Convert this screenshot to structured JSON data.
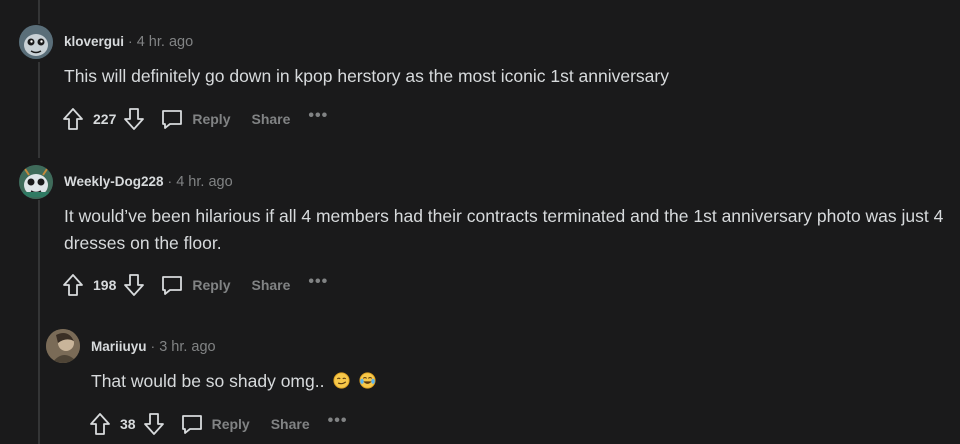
{
  "comments": [
    {
      "author": "klovergui",
      "time": "4 hr. ago",
      "text": "This will definitely go down in kpop herstory as the most iconic 1st anniversary",
      "score": "227",
      "reply_label": "Reply",
      "share_label": "Share",
      "more_label": "•••"
    },
    {
      "author": "Weekly-Dog228",
      "time": "4 hr. ago",
      "text": "It would’ve been hilarious if all 4 members had their contracts terminated and the 1st anniversary photo was just 4 dresses on the floor.",
      "score": "198",
      "reply_label": "Reply",
      "share_label": "Share",
      "more_label": "•••"
    },
    {
      "author": "Mariiuyu",
      "time": "3 hr. ago",
      "text": "That would be so shady omg..",
      "score": "38",
      "reply_label": "Reply",
      "share_label": "Share",
      "more_label": "•••",
      "emojis": [
        "smirking-face",
        "face-with-tears-of-joy"
      ]
    }
  ],
  "separator": "·",
  "colors": {
    "background": "#1a1a1b",
    "text": "#d7dadc",
    "muted": "#818384",
    "thread_line": "#343536"
  }
}
